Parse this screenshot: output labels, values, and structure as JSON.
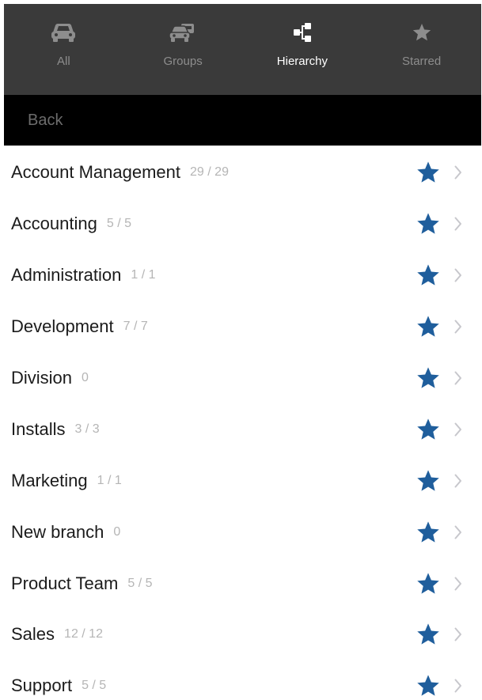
{
  "tabs": [
    {
      "label": "All",
      "icon": "car-icon",
      "active": false
    },
    {
      "label": "Groups",
      "icon": "groups-icon",
      "active": false
    },
    {
      "label": "Hierarchy",
      "icon": "hierarchy-icon",
      "active": true
    },
    {
      "label": "Starred",
      "icon": "star-icon",
      "active": false
    }
  ],
  "back": {
    "label": "Back"
  },
  "rows": [
    {
      "name": "Account Management",
      "count": "29 / 29",
      "starred": true
    },
    {
      "name": "Accounting",
      "count": "5 / 5",
      "starred": true
    },
    {
      "name": "Administration",
      "count": "1 / 1",
      "starred": true
    },
    {
      "name": "Development",
      "count": "7 / 7",
      "starred": true
    },
    {
      "name": "Division",
      "count": "0",
      "starred": true
    },
    {
      "name": "Installs",
      "count": "3 / 3",
      "starred": true
    },
    {
      "name": "Marketing",
      "count": "1 / 1",
      "starred": true
    },
    {
      "name": "New branch",
      "count": "0",
      "starred": true
    },
    {
      "name": "Product Team",
      "count": "5 / 5",
      "starred": true
    },
    {
      "name": "Sales",
      "count": "12 / 12",
      "starred": true
    },
    {
      "name": "Support",
      "count": "5 / 5",
      "starred": true
    }
  ],
  "colors": {
    "tabbar_bg": "#3a3a3a",
    "tab_inactive": "#8d8d8d",
    "tab_active": "#ffffff",
    "backbar_bg": "#000000",
    "back_text": "#6c6c6c",
    "star": "#1f5e9c",
    "chevron": "#c7c7cc",
    "count_text": "#b5b5b5"
  }
}
